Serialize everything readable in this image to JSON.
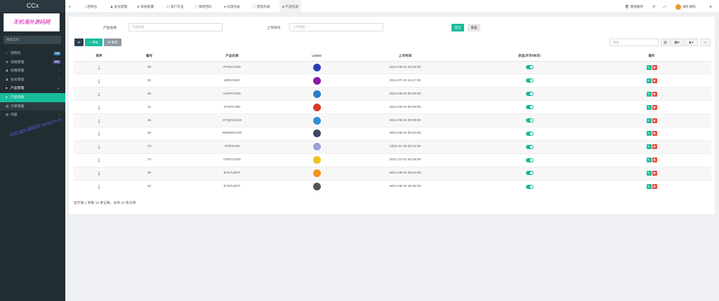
{
  "sidebar": {
    "brand": "CCx",
    "banner": "天机海外源码网",
    "search_placeholder": "搜索菜单",
    "watermark": "天机海外源码网 tianjiym.cc",
    "items": [
      {
        "label": "控制台",
        "badge": "hot",
        "badge_color": "#3c8dbc"
      },
      {
        "label": "常规管理",
        "badge": "new",
        "badge_color": "#605ca8"
      },
      {
        "label": "权限管理",
        "arrow": "‹"
      },
      {
        "label": "会员管理",
        "arrow": "‹"
      },
      {
        "label": "产品管理",
        "arrow": "⌄"
      },
      {
        "label": "产品列表"
      },
      {
        "label": "订单管理"
      },
      {
        "label": "内容",
        "arrow": "‹"
      }
    ]
  },
  "topbar": {
    "tabs": [
      "控制台",
      "会员管理",
      "系统配置",
      "客户实名",
      "我的团队",
      "充值列表",
      "提现列表",
      "产品列表"
    ],
    "clear_cache": "清除缓存",
    "user": "海外源码"
  },
  "filters": {
    "name_label": "产品名称",
    "name_placeholder": "产品名称",
    "time_label": "上市时间",
    "time_placeholder": "上市时间",
    "submit": "提交",
    "reset": "重置"
  },
  "toolbar": {
    "add": "添加",
    "more": "更多",
    "search_placeholder": "搜索"
  },
  "table": {
    "headers": [
      "排序",
      "编号",
      "产品名称",
      "LOGO",
      "上市时间",
      "状态(开市/休市)",
      "操作"
    ],
    "rows": [
      {
        "sort": "1",
        "id": "29",
        "name": "PVSC/USD",
        "time": "2021-08-24 23:22:00",
        "logo": "#2b3eb8"
      },
      {
        "sort": "1",
        "id": "31",
        "name": "WEC/USD",
        "time": "2021-07-23 14:17:00",
        "logo": "#8a1aa8"
      },
      {
        "sort": "1",
        "id": "40",
        "name": "HCPF/USD",
        "time": "2021-08-23 00:00:00",
        "logo": "#2a7fc8"
      },
      {
        "sort": "1",
        "id": "41",
        "name": "STSP/USD",
        "time": "2021-08-23 00:00:00",
        "logo": "#d63a2a"
      },
      {
        "sort": "1",
        "id": "45",
        "name": "CFQZ1/USD",
        "time": "2021-08-23 00:00:00",
        "logo": "#2f8fd8"
      },
      {
        "sort": "1",
        "id": "46",
        "name": "WWER/USD",
        "time": "2021-08-23 00:00:00",
        "logo": "#3a4a5e"
      },
      {
        "sort": "1",
        "id": "73",
        "name": "GTE/USD",
        "time": "2021-12-15 04:11:00",
        "logo": "#9aa0d8"
      },
      {
        "sort": "1",
        "id": "74",
        "name": "OTEC/USD",
        "time": "2021-12-21 02:48:00",
        "logo": "#f0c020"
      },
      {
        "sort": "2",
        "id": "36",
        "name": "BTC/USDT",
        "time": "2021-08-23 00:00:00",
        "logo": "#f7931a"
      },
      {
        "sort": "2",
        "id": "42",
        "name": "ETH/USDT",
        "time": "2021-09-16 19:36:00",
        "logo": "#555555"
      }
    ]
  },
  "footer": "显示第 1 到第 10 条记录，总共 10 条记录"
}
